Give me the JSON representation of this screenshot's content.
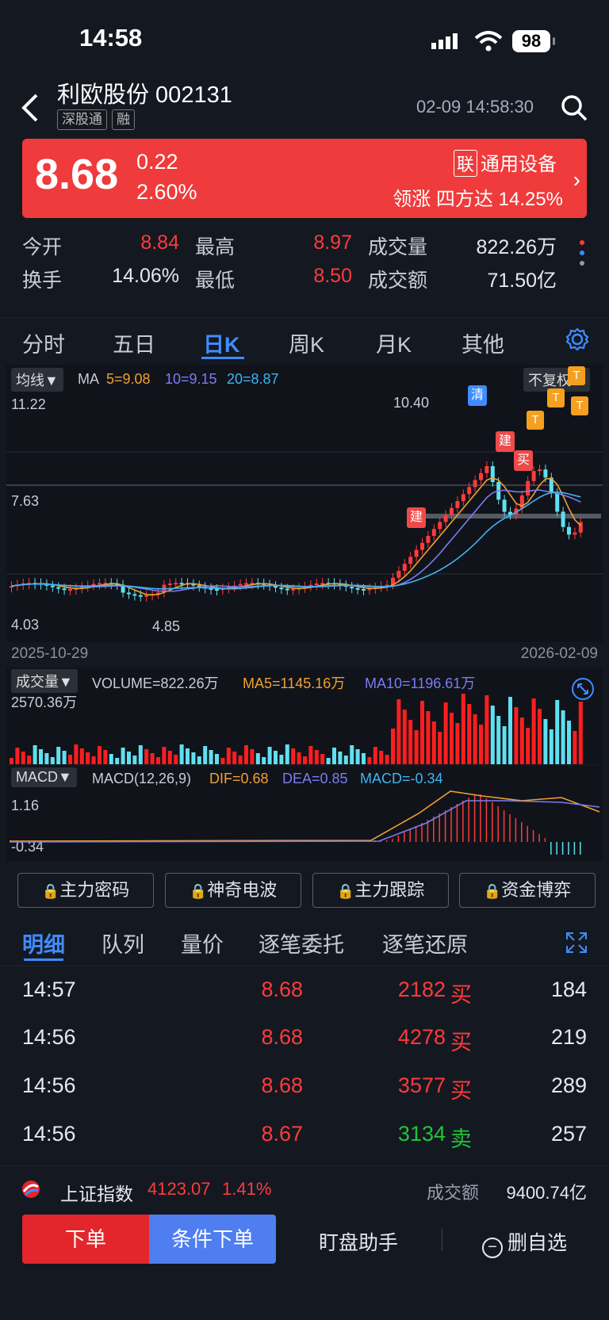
{
  "status": {
    "time": "14:58",
    "battery": "98"
  },
  "header": {
    "title": "利欧股份 002131",
    "tags": [
      "深股通",
      "融"
    ],
    "datetime": "02-09 14:58:30"
  },
  "quote": {
    "price": "8.68",
    "change": "0.22",
    "change_pct": "2.60%",
    "sector_tag": "联",
    "sector": "通用设备",
    "lead_label": "领涨",
    "lead_stock": "四方达",
    "lead_pct": "14.25%"
  },
  "stats": {
    "open_label": "今开",
    "open": "8.84",
    "high_label": "最高",
    "high": "8.97",
    "vol_label": "成交量",
    "vol": "822.26万",
    "turn_label": "换手",
    "turn": "14.06%",
    "low_label": "最低",
    "low": "8.50",
    "amt_label": "成交额",
    "amt": "71.50亿"
  },
  "colors": {
    "up": "#ff3b3b",
    "down": "#21c43a",
    "accent": "#3f8cff",
    "banner": "#ef3b3b"
  },
  "tabs": [
    "分时",
    "五日",
    "日K",
    "周K",
    "月K",
    "其他"
  ],
  "kline": {
    "mode_chip": "均线▼",
    "ma_label": "MA",
    "ma5": "5=9.08",
    "ma10": "10=9.15",
    "ma20": "20=8.87",
    "adjust_chip": "不复权▼",
    "y_top": "11.22",
    "y_mid": "7.63",
    "y_bot": "4.03",
    "peak_label": "10.40",
    "low_label": "4.85",
    "date_start": "2025-10-29",
    "date_end": "2026-02-09",
    "marker_qing": "清",
    "marker_jian": "建",
    "marker_mai": "买",
    "marker_t": "T"
  },
  "volume": {
    "chip": "成交量▼",
    "volume": "VOLUME=822.26万",
    "ma5": "MA5=1145.16万",
    "ma10": "MA10=1196.61万",
    "y_max": "2570.36万"
  },
  "macd": {
    "chip": "MACD▼",
    "params": "MACD(12,26,9)",
    "dif": "DIF=0.68",
    "dea": "DEA=0.85",
    "macd": "MACD=-0.34",
    "y_top": "1.16",
    "y_bot": "-0.34"
  },
  "locked": [
    "主力密码",
    "神奇电波",
    "主力跟踪",
    "资金博弈"
  ],
  "detail_tabs": [
    "明细",
    "队列",
    "量价",
    "逐笔委托",
    "逐笔还原"
  ],
  "trades": [
    {
      "time": "14:57",
      "price": "8.68",
      "vol": "2182",
      "side": "买",
      "count": "184",
      "dir": "up"
    },
    {
      "time": "14:56",
      "price": "8.68",
      "vol": "4278",
      "side": "买",
      "count": "219",
      "dir": "up"
    },
    {
      "time": "14:56",
      "price": "8.68",
      "vol": "3577",
      "side": "买",
      "count": "289",
      "dir": "up"
    },
    {
      "time": "14:56",
      "price": "8.67",
      "vol": "3134",
      "side": "卖",
      "count": "257",
      "dir": "down"
    }
  ],
  "index": {
    "name": "上证指数",
    "value": "4123.07",
    "pct": "1.41%",
    "amt_label": "成交额",
    "amt": "9400.74亿"
  },
  "actions": {
    "order": "下单",
    "cond_order": "条件下单",
    "assist": "盯盘助手",
    "del_fav": "删自选"
  }
}
